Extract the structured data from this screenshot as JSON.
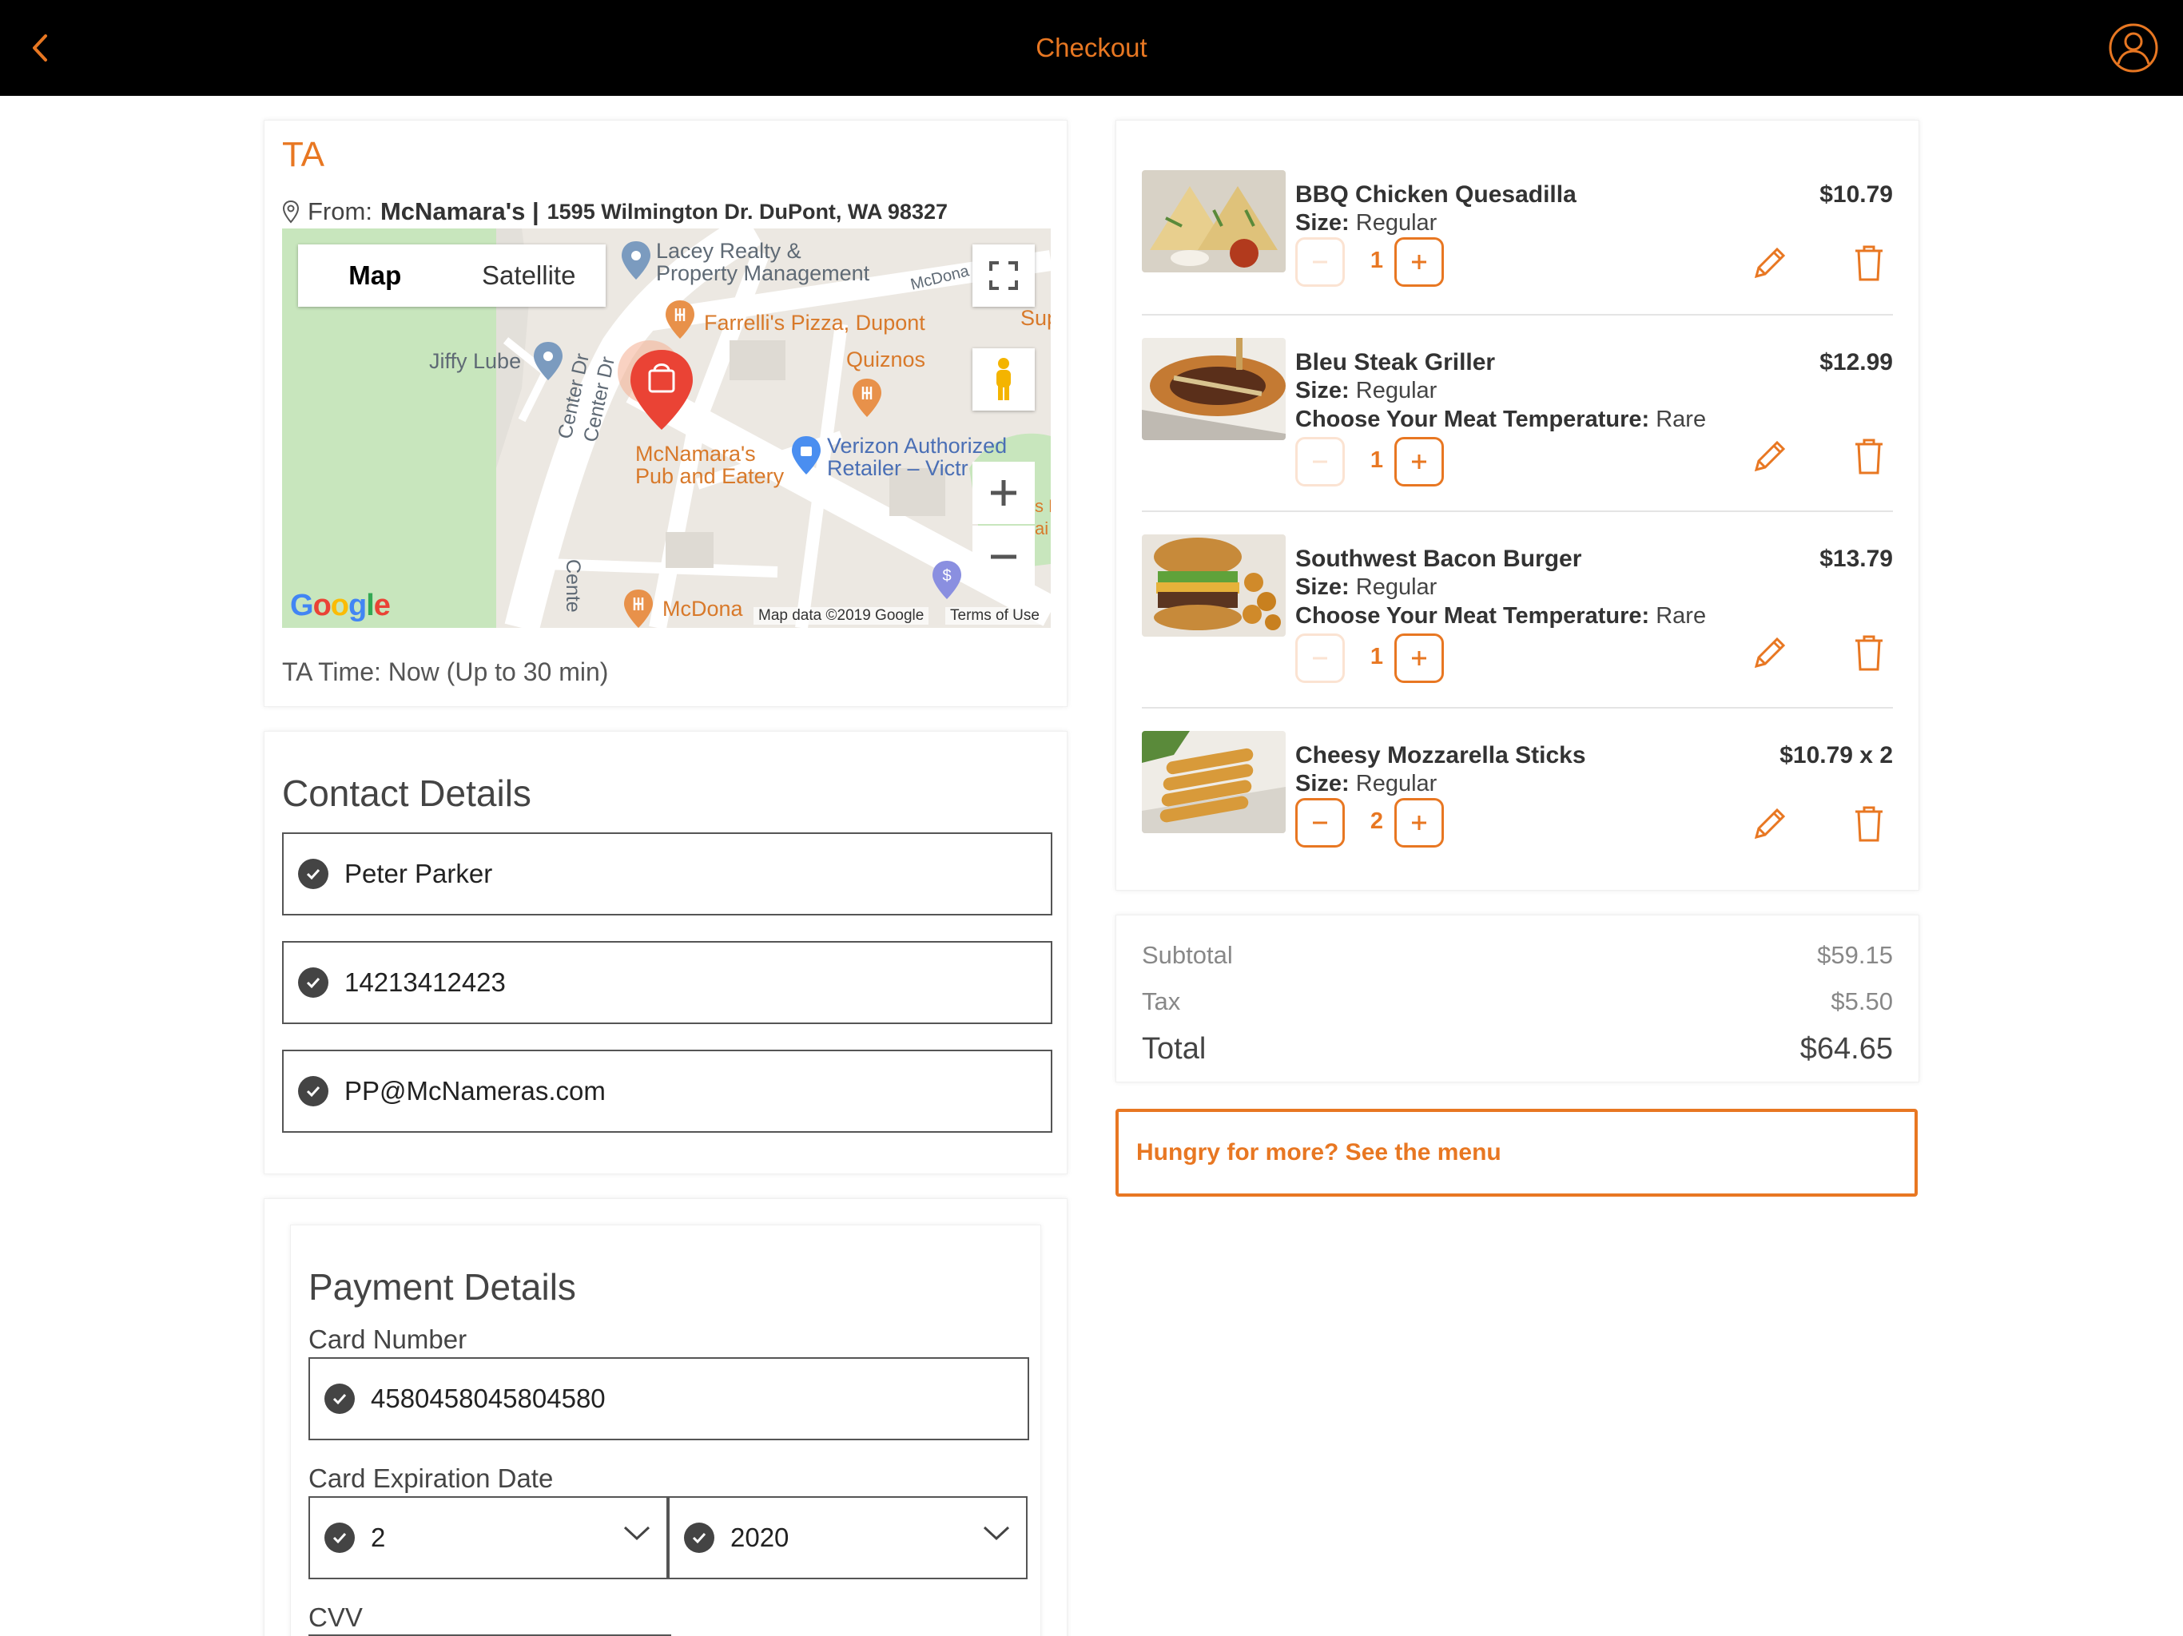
{
  "header": {
    "title": "Checkout",
    "accent": "#e87722"
  },
  "pickup": {
    "title": "TA",
    "from_label": "From:",
    "restaurant": "McNamara's |",
    "address": "1595 Wilmington Dr. DuPont, WA 98327",
    "time": "TA Time: Now (Up to 30 min)",
    "map": {
      "tab_map": "Map",
      "tab_satellite": "Satellite",
      "labels": {
        "lacey": "Lacey Realty &",
        "lacey2": "Property Management",
        "farrellis": "Farrelli's Pizza, Dupont",
        "quiznos": "Quiznos",
        "jiffy": "Jiffy Lube",
        "mcnamaras": "McNamara's",
        "mcnamaras2": "Pub and Eatery",
        "verizon": "Verizon Authorized",
        "verizon2": "Retailer – Victr",
        "mcdonalds": "McDona",
        "mcdona_top": "McDona",
        "center1": "Center Dr",
        "center2": "Center Dr",
        "center3": "Cente",
        "sup": "Sup",
        "sf": "s F",
        "ai": "ai"
      },
      "google": "Google",
      "map_data": "Map data ©2019 Google",
      "terms": "Terms of Use"
    }
  },
  "contact": {
    "title": "Contact Details",
    "name": "Peter Parker",
    "phone": "14213412423",
    "email": "PP@McNameras.com"
  },
  "payment": {
    "title": "Payment Details",
    "card_number_label": "Card Number",
    "card_number": "4580458045804580",
    "expiry_label": "Card Expiration Date",
    "expiry_month": "2",
    "expiry_year": "2020",
    "cvv_label": "CVV"
  },
  "order": {
    "items": [
      {
        "name": "BBQ Chicken Quesadilla",
        "size_label": "Size:",
        "size": "Regular",
        "temp_label": "",
        "temp": "",
        "price": "$10.79",
        "qty": "1"
      },
      {
        "name": "Bleu Steak Griller",
        "size_label": "Size:",
        "size": "Regular",
        "temp_label": "Choose Your Meat Temperature:",
        "temp": "Rare",
        "price": "$12.99",
        "qty": "1"
      },
      {
        "name": "Southwest Bacon Burger",
        "size_label": "Size:",
        "size": "Regular",
        "temp_label": "Choose Your Meat Temperature:",
        "temp": "Rare",
        "price": "$13.79",
        "qty": "1"
      },
      {
        "name": "Cheesy Mozzarella Sticks",
        "size_label": "Size:",
        "size": "Regular",
        "temp_label": "",
        "temp": "",
        "price": "$10.79 x 2",
        "qty": "2"
      }
    ]
  },
  "totals": {
    "subtotal_label": "Subtotal",
    "subtotal": "$59.15",
    "tax_label": "Tax",
    "tax": "$5.50",
    "total_label": "Total",
    "total": "$64.65"
  },
  "menu_link": "Hungry for more? See the menu"
}
